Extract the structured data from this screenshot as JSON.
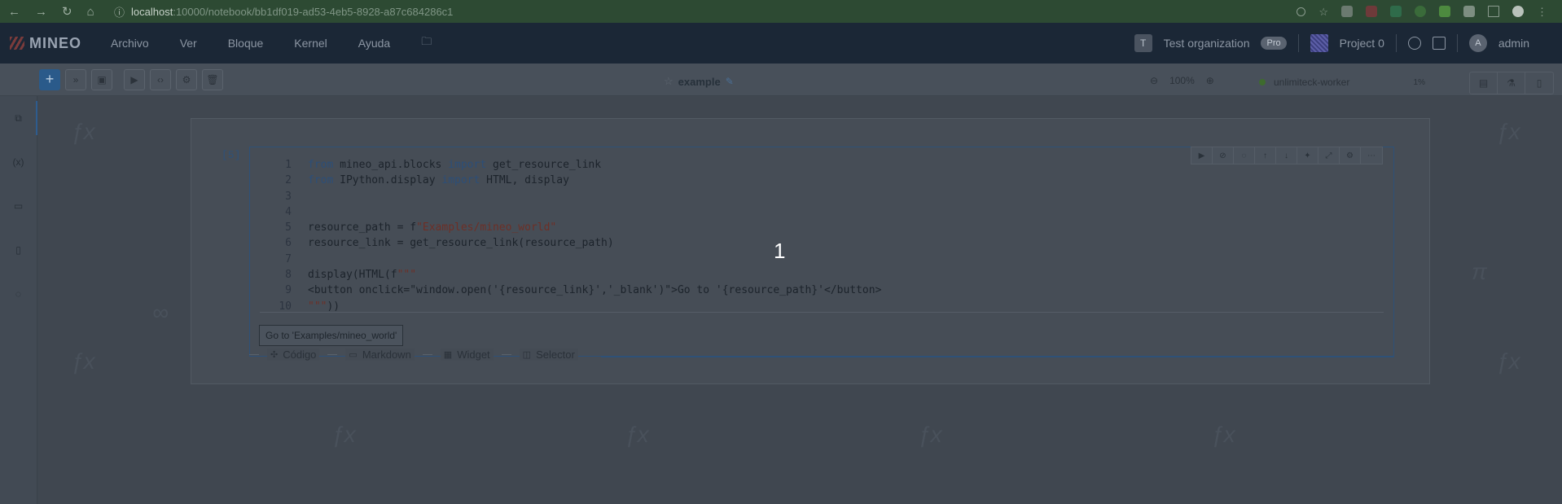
{
  "browser": {
    "url_host": "localhost",
    "url_path": ":10000/notebook/bb1df019-ad53-4eb5-8928-a87c684286c1"
  },
  "header": {
    "logo": "MINEO",
    "menu": [
      "Archivo",
      "Ver",
      "Bloque",
      "Kernel",
      "Ayuda"
    ],
    "org_initial": "T",
    "org_name": "Test organization",
    "pro_badge": "Pro",
    "project": "Project 0",
    "user_initial": "A",
    "user": "admin"
  },
  "toolbar": {
    "notebook_title": "example",
    "zoom": "100%",
    "worker": "unlimiteck-worker",
    "worker_usage": "1%"
  },
  "cell": {
    "execution_count": "[5]",
    "lines": [
      "from mineo_api.blocks import get_resource_link",
      "from IPython.display import HTML, display",
      "",
      "",
      "resource_path = f\"Examples/mineo_world\"",
      "resource_link = get_resource_link(resource_path)",
      "",
      "display(HTML(f\"\"\"",
      "<button onclick=\"window.open('{resource_link}','_blank')\">Go to '{resource_path}'</button>",
      "\"\"\"))"
    ],
    "output_button": "Go to 'Examples/mineo_world'"
  },
  "add_options": [
    "Código",
    "Markdown",
    "Widget",
    "Selector"
  ],
  "overlay_number": "1",
  "icons": {
    "sidebar": [
      "copy-icon",
      "variables-icon",
      "folder-icon",
      "clipboard-icon",
      "chat-icon"
    ],
    "cell_tools": [
      "run-icon",
      "disable-icon",
      "comment-icon",
      "arrow-up-icon",
      "arrow-down-icon",
      "magic-icon",
      "expand-icon",
      "settings-icon",
      "more-icon"
    ]
  }
}
